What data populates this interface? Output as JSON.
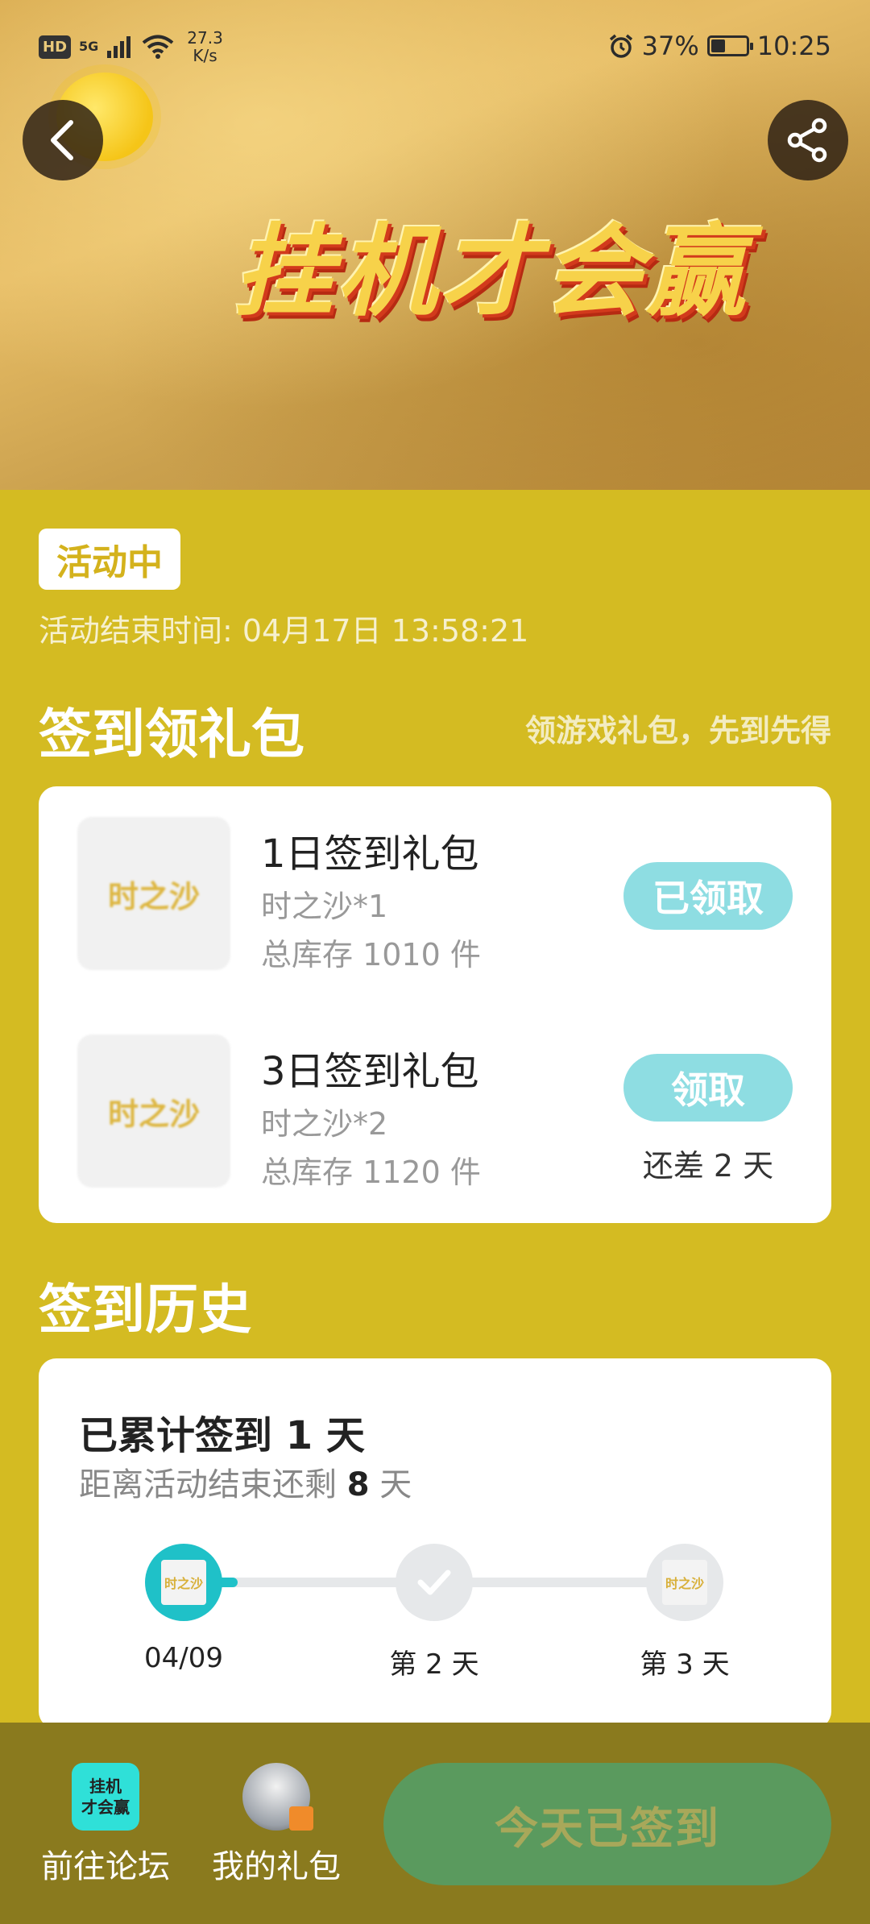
{
  "status_bar": {
    "hd": "HD",
    "network": "5G",
    "speed_value": "27.3",
    "speed_unit": "K/s",
    "battery": "37%",
    "battery_level": 0.37,
    "time": "10:25"
  },
  "hero": {
    "title": "挂机才会赢"
  },
  "activity": {
    "status": "活动中",
    "end_time": "活动结束时间: 04月17日 13:58:21"
  },
  "signin": {
    "title": "签到领礼包",
    "subtitle": "领游戏礼包，先到先得",
    "gifts": [
      {
        "thumb": "时之沙",
        "name": "1日签到礼包",
        "item": "时之沙*1",
        "stock": "总库存 1010 件",
        "button": "已领取",
        "note": ""
      },
      {
        "thumb": "时之沙",
        "name": "3日签到礼包",
        "item": "时之沙*2",
        "stock": "总库存 1120 件",
        "button": "领取",
        "note": "还差 2 天"
      }
    ]
  },
  "history": {
    "title": "签到历史",
    "total": "已累计签到 1 天",
    "remain_prefix": "距离活动结束还剩",
    "remain_days": "8",
    "remain_suffix": "天",
    "progress": 0.1,
    "nodes": [
      {
        "label": "04/09",
        "thumb": "时之沙"
      },
      {
        "label": "第 2 天",
        "thumb": ""
      },
      {
        "label": "第 3 天",
        "thumb": "时之沙"
      }
    ]
  },
  "bottom": {
    "forum_icon_line1": "挂机",
    "forum_icon_line2": "才会赢",
    "forum_label": "前往论坛",
    "gifts_label": "我的礼包",
    "checked_label": "今天已签到"
  },
  "colors": {
    "page_bg": "#d4bb22",
    "accent_teal": "#1fc1c8",
    "pill_teal": "#8edde2",
    "bottom_bar": "#8a7a1e",
    "checked_btn": "#5a9a5e"
  }
}
